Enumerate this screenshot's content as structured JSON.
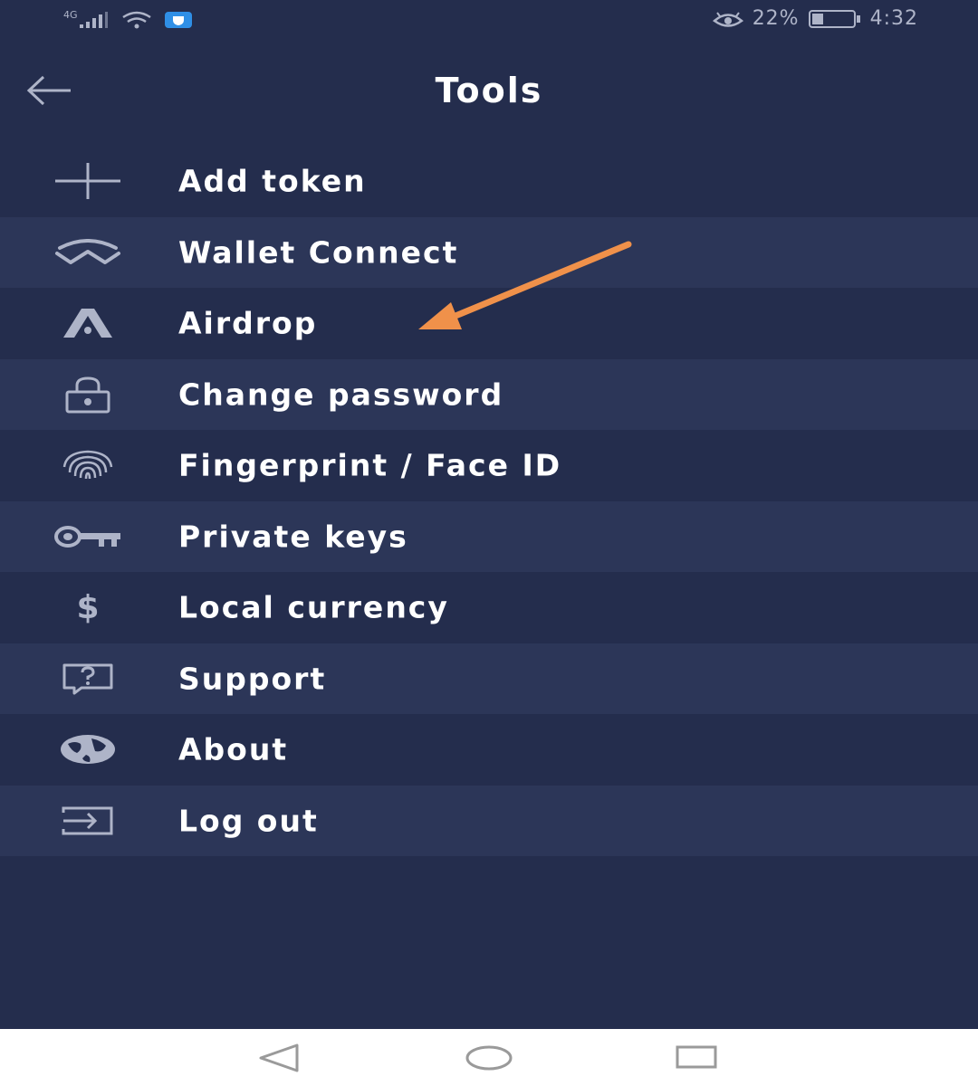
{
  "status_bar": {
    "network": "4G",
    "battery_percent": "22%",
    "time": "4:32"
  },
  "header": {
    "title": "Tools"
  },
  "menu": {
    "items": [
      {
        "label": "Add token",
        "icon": "plus-icon"
      },
      {
        "label": "Wallet Connect",
        "icon": "wallet-connect-icon"
      },
      {
        "label": "Airdrop",
        "icon": "airdrop-icon"
      },
      {
        "label": "Change password",
        "icon": "lock-icon"
      },
      {
        "label": "Fingerprint / Face ID",
        "icon": "fingerprint-icon"
      },
      {
        "label": "Private keys",
        "icon": "key-icon"
      },
      {
        "label": "Local currency",
        "icon": "dollar-icon"
      },
      {
        "label": "Support",
        "icon": "question-icon"
      },
      {
        "label": "About",
        "icon": "globe-icon"
      },
      {
        "label": "Log out",
        "icon": "logout-icon"
      }
    ],
    "dollar_glyph": "$"
  },
  "colors": {
    "background": "#242d4d",
    "row_alt": "#2c3658",
    "icon": "#aeb4c8",
    "annotation_arrow": "#f0914a"
  }
}
